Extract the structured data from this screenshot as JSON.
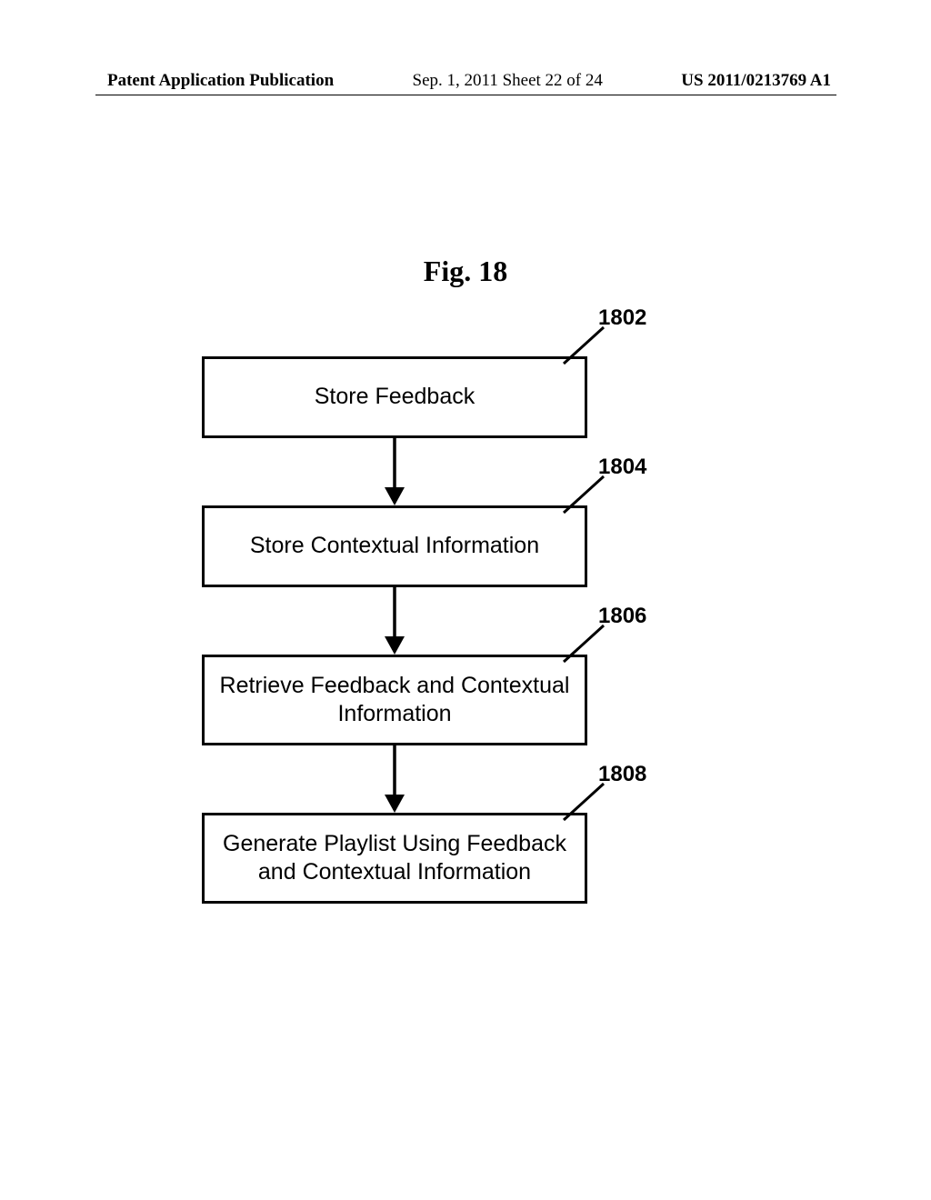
{
  "header": {
    "left": "Patent Application Publication",
    "center": "Sep. 1, 2011  Sheet 22 of 24",
    "right": "US 2011/0213769 A1"
  },
  "figure": {
    "title": "Fig. 18"
  },
  "boxes": {
    "b1": {
      "label": "Store Feedback",
      "ref": "1802"
    },
    "b2": {
      "label": "Store Contextual Information",
      "ref": "1804"
    },
    "b3": {
      "label": "Retrieve Feedback and Contextual Information",
      "ref": "1806"
    },
    "b4": {
      "label": "Generate Playlist Using Feedback and Contextual Information",
      "ref": "1808"
    }
  }
}
